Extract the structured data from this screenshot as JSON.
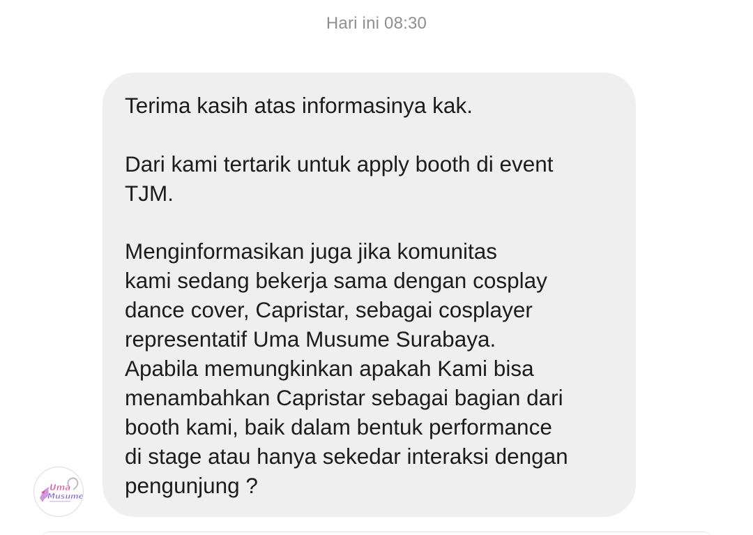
{
  "conversation": {
    "timestamp": "Hari ini 08:30",
    "message": {
      "lines": [
        "Terima kasih atas informasinya kak.",
        "Dari kami tertarik untuk apply booth di event",
        "TJM.",
        "Menginformasikan juga jika komunitas",
        "kami sedang bekerja sama dengan cosplay",
        "dance cover, Capristar, sebagai cosplayer",
        "representatif Uma Musume Surabaya.",
        "Apabila memungkinkan apakah Kami bisa",
        "menambahkan Capristar sebagai bagian dari",
        "booth kami, baik dalam bentuk performance",
        "di stage atau hanya sekedar interaksi dengan",
        "pengunjung ?"
      ]
    },
    "sender_avatar": {
      "logo_text_line1": "Uma",
      "logo_text_line2": "Musume",
      "colors": {
        "logo_pink": "#e34f9c",
        "logo_purple": "#8a63d2",
        "logo_blue": "#5a7fd6"
      }
    }
  }
}
